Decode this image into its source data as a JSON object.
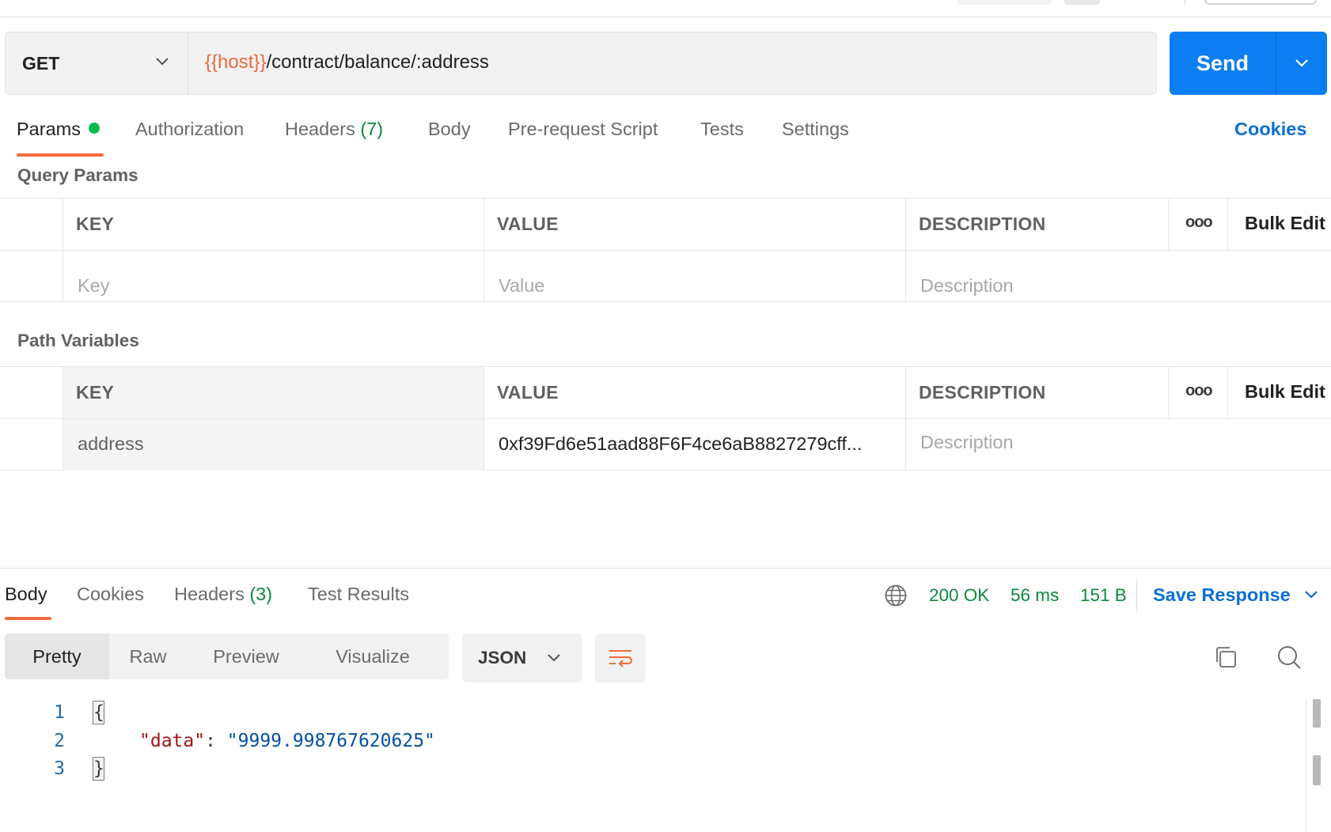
{
  "request": {
    "method": "GET",
    "url_var": "{{host}}",
    "url_path": "/contract/balance/:address",
    "send_label": "Send"
  },
  "request_tabs": {
    "params": "Params",
    "authorization": "Authorization",
    "headers": "Headers",
    "headers_count": "(7)",
    "body": "Body",
    "prerequest": "Pre-request Script",
    "tests": "Tests",
    "settings": "Settings",
    "cookies": "Cookies"
  },
  "query_params": {
    "title": "Query Params",
    "headers": {
      "key": "KEY",
      "value": "VALUE",
      "description": "DESCRIPTION"
    },
    "more": "ooo",
    "bulk_edit": "Bulk Edit",
    "placeholders": {
      "key": "Key",
      "value": "Value",
      "description": "Description"
    }
  },
  "path_variables": {
    "title": "Path Variables",
    "headers": {
      "key": "KEY",
      "value": "VALUE",
      "description": "DESCRIPTION"
    },
    "more": "ooo",
    "bulk_edit": "Bulk Edit",
    "rows": [
      {
        "key": "address",
        "value": "0xf39Fd6e51aad88F6F4ce6aB8827279cff...",
        "description_placeholder": "Description"
      }
    ]
  },
  "response": {
    "tabs": {
      "body": "Body",
      "cookies": "Cookies",
      "headers": "Headers",
      "headers_count": "(3)",
      "test_results": "Test Results"
    },
    "status": "200 OK",
    "time": "56 ms",
    "size": "151 B",
    "save_response": "Save Response",
    "view_modes": [
      "Pretty",
      "Raw",
      "Preview",
      "Visualize"
    ],
    "format": "JSON",
    "line_numbers": [
      "1",
      "2",
      "3"
    ],
    "json": {
      "open": "{",
      "key": "\"data\"",
      "colon": ": ",
      "value": "\"9999.998767620625\"",
      "close": "}"
    }
  },
  "colors": {
    "accent": "#0c7ef2",
    "tab_underline": "#f26b3a",
    "status_ok": "#0a8a3a",
    "url_variable": "#eb6a3a"
  },
  "icons": [
    "chevron-down-icon",
    "globe-icon",
    "wrap-lines-icon",
    "copy-icon",
    "search-icon",
    "status-dot-icon"
  ]
}
